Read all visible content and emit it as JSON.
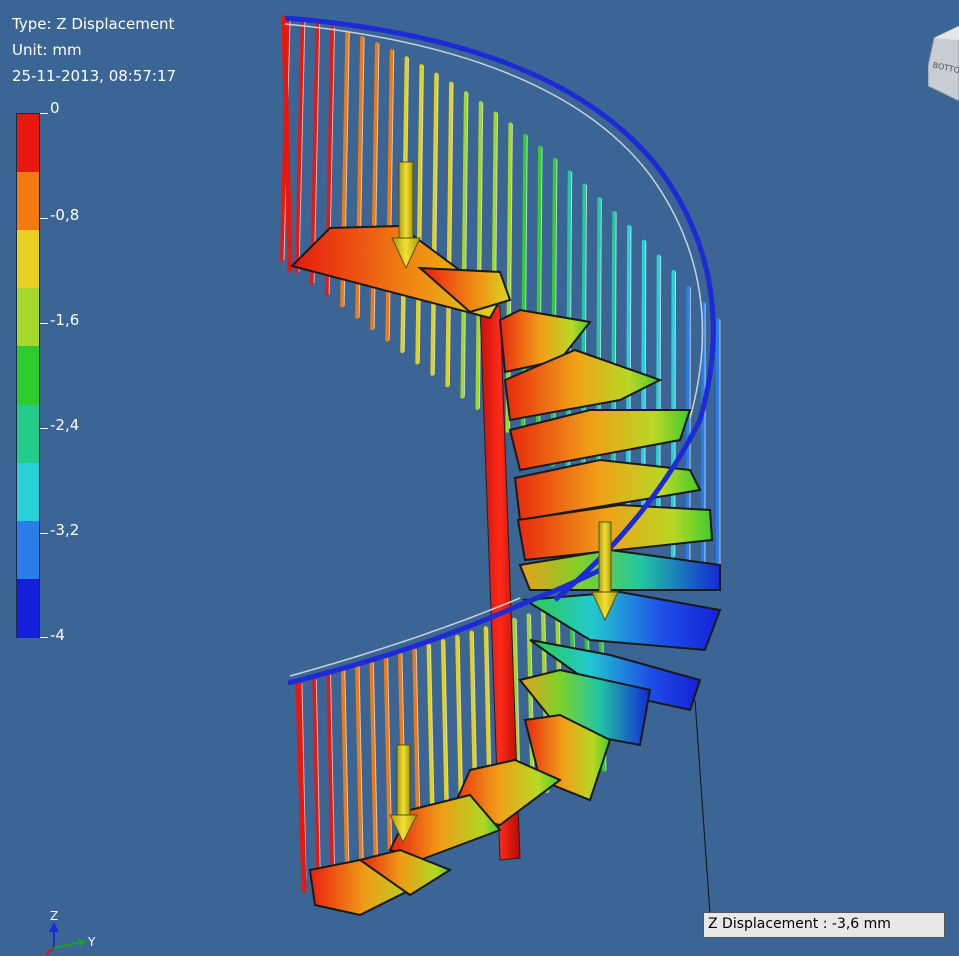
{
  "result_info": {
    "type_line": "Type: Z Displacement",
    "unit_line": "Unit: mm",
    "timestamp_line": "25-11-2013, 08:57:17"
  },
  "legend": {
    "labels": [
      "0",
      "-0,8",
      "-1,6",
      "-2,4",
      "-3,2",
      "-4"
    ],
    "colors": [
      "#e8180e",
      "#f27a10",
      "#e6d21e",
      "#a4d82a",
      "#2fcc2e",
      "#22cc8a",
      "#2ad0d8",
      "#2a7ee8",
      "#1420d8"
    ]
  },
  "probe": {
    "label": "Z Displacement : -3,6 mm"
  },
  "triad": {
    "z_label": "Z",
    "y_label": "Y"
  },
  "view_cube": {
    "face_label": "BOTTOM"
  },
  "colors": {
    "background": "#3b6594",
    "handrail": "#1d2ad6",
    "column": "#e8180e",
    "load_arrow": "#d8c81a"
  }
}
